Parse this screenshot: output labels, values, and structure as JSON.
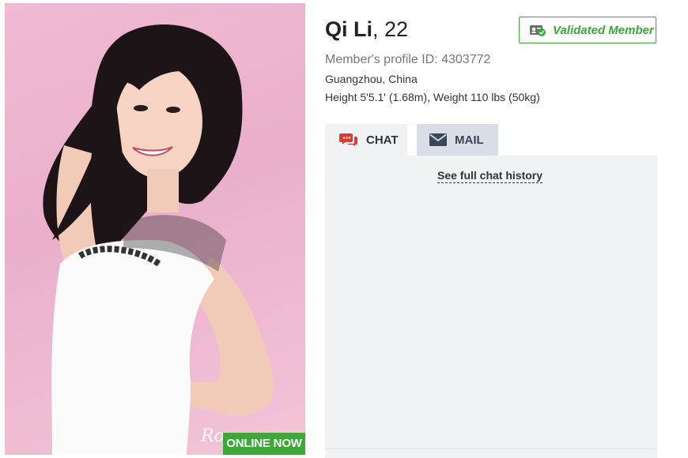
{
  "profile": {
    "name": "Qi Li",
    "age_text": ", 22",
    "profile_id_text": "Member's profile ID: 4303772",
    "location": "Guangzhou, China",
    "stats": "Height 5'5.1' (1.68m), Weight 110 lbs (50kg)",
    "validated_label": "Validated Member"
  },
  "photo": {
    "status_badge": "ONLINE NOW",
    "watermark": "Ro"
  },
  "tabs": [
    {
      "label": "CHAT",
      "icon": "chat-bubbles-icon",
      "active": true
    },
    {
      "label": "MAIL",
      "icon": "envelope-icon",
      "active": false
    }
  ],
  "chat": {
    "history_link": "See full chat history"
  },
  "colors": {
    "accent_green": "#3aa935",
    "chat_icon_red": "#e03a2f",
    "panel_bg": "#f1f2f4",
    "inactive_tab_bg": "#d9dee6"
  }
}
